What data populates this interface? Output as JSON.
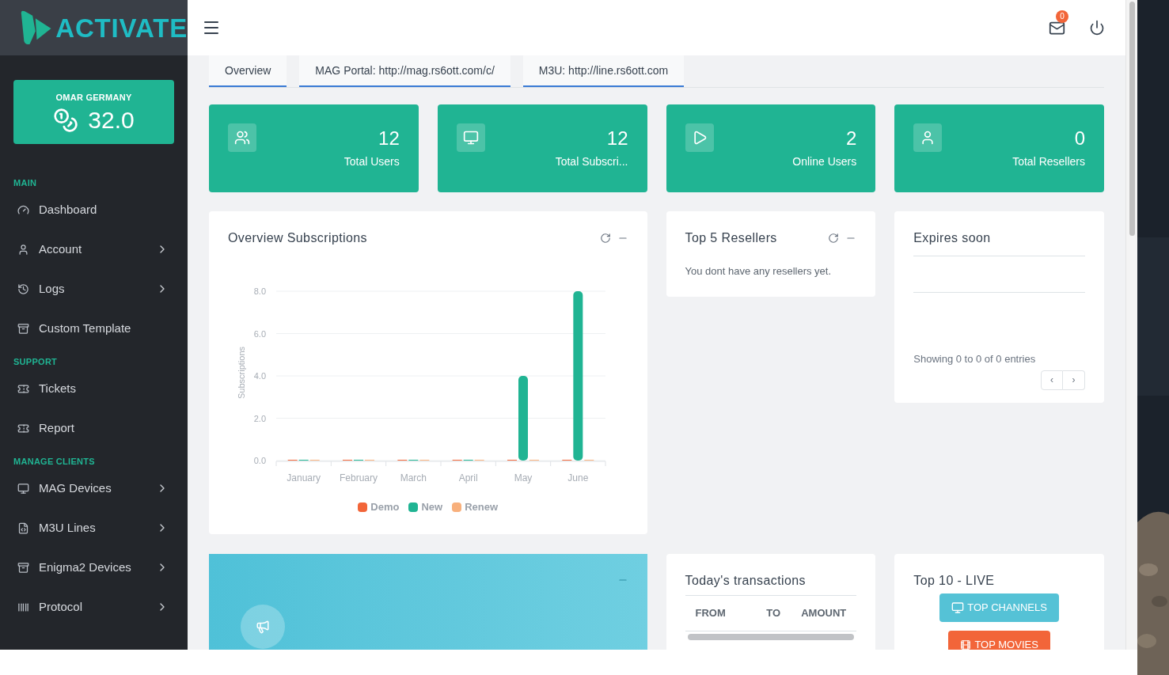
{
  "brand": {
    "name": "ACTIVATE"
  },
  "balance": {
    "owner": "OMAR GERMANY",
    "amount": "32.0"
  },
  "sidebar": {
    "sections": [
      {
        "label": "MAIN",
        "items": [
          {
            "label": "Dashboard",
            "kind": "link"
          },
          {
            "label": "Account",
            "kind": "menu"
          },
          {
            "label": "Logs",
            "kind": "menu"
          },
          {
            "label": "Custom Template",
            "kind": "link"
          }
        ]
      },
      {
        "label": "SUPPORT",
        "items": [
          {
            "label": "Tickets",
            "kind": "link"
          },
          {
            "label": "Report",
            "kind": "link"
          }
        ]
      },
      {
        "label": "MANAGE CLIENTS",
        "items": [
          {
            "label": "MAG Devices",
            "kind": "menu"
          },
          {
            "label": "M3U Lines",
            "kind": "menu"
          },
          {
            "label": "Enigma2 Devices",
            "kind": "menu"
          },
          {
            "label": "Protocol",
            "kind": "menu"
          }
        ]
      }
    ]
  },
  "header": {
    "mail_badge": "0"
  },
  "tabs": [
    {
      "label": "Overview"
    },
    {
      "label": "MAG Portal: http://mag.rs6ott.com/c/"
    },
    {
      "label": "M3U: http://line.rs6ott.com"
    }
  ],
  "stats": [
    {
      "value": "12",
      "label": "Total Users"
    },
    {
      "value": "12",
      "label": "Total Subscri..."
    },
    {
      "value": "2",
      "label": "Online Users"
    },
    {
      "value": "0",
      "label": "Total Resellers"
    }
  ],
  "overview": {
    "title": "Overview Subscriptions",
    "chart_data": {
      "type": "bar",
      "grid": true,
      "legend": "bottom",
      "ylabel": "Subscriptions",
      "categories": [
        "January",
        "February",
        "March",
        "April",
        "May",
        "June"
      ],
      "yticks": [
        {
          "value": 0,
          "label": "0.0"
        },
        {
          "value": 2,
          "label": "2.0"
        },
        {
          "value": 4,
          "label": "4.0"
        },
        {
          "value": 6,
          "label": "6.0"
        },
        {
          "value": 8,
          "label": "8.0"
        }
      ],
      "ylim": [
        0,
        8
      ],
      "series": [
        {
          "name": "Demo",
          "color": "#f26539",
          "values": [
            0,
            0,
            0,
            0,
            0,
            0
          ]
        },
        {
          "name": "New",
          "color": "#20b493",
          "values": [
            0,
            0,
            0,
            0,
            4,
            8
          ]
        },
        {
          "name": "Renew",
          "color": "#f8b07c",
          "values": [
            0,
            0,
            0,
            0,
            0,
            0
          ]
        }
      ]
    }
  },
  "resellers": {
    "title": "Top 5 Resellers",
    "message": "You dont have any resellers yet."
  },
  "expires": {
    "title": "Expires soon",
    "info": "Showing 0 to 0 of 0 entries",
    "prev": "‹",
    "next": "›"
  },
  "transactions": {
    "title": "Today's transactions",
    "columns": [
      "FROM",
      "TO",
      "AMOUNT"
    ]
  },
  "top_live": {
    "title": "Top 10 - LIVE",
    "buttons": [
      {
        "label": "TOP CHANNELS",
        "kind": "channels"
      },
      {
        "label": "TOP MOVIES",
        "kind": "movies"
      }
    ]
  }
}
